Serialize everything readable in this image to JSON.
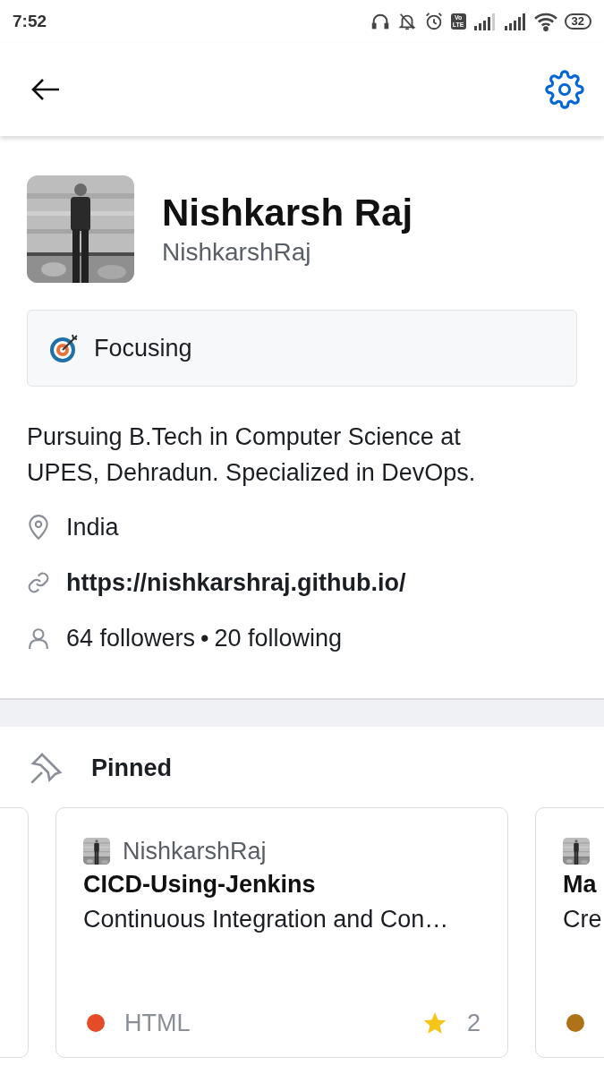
{
  "status_bar": {
    "time": "7:52",
    "volte": [
      "Vo",
      "LTE"
    ],
    "battery": "32"
  },
  "profile": {
    "name": "Nishkarsh Raj",
    "login": "NishkarshRaj",
    "status": "Focusing",
    "bio": "Pursuing B.Tech in Computer Science at UPES, Dehradun. Specialized in DevOps.",
    "location": "India",
    "website": "https://nishkarshraj.github.io/",
    "followers": "64 followers",
    "separator": "•",
    "following": "20 following"
  },
  "pinned": {
    "title": "Pinned",
    "cards": [
      {
        "kind": "edge"
      },
      {
        "kind": "full",
        "owner": "NishkarshRaj",
        "name": "CICD-Using-Jenkins",
        "description": "Continuous Integration and Con…",
        "language": "HTML",
        "color": "#e34c26",
        "stars": "2"
      },
      {
        "kind": "full",
        "name": "Ma",
        "description": "Cre",
        "color": "#b07219"
      }
    ]
  }
}
